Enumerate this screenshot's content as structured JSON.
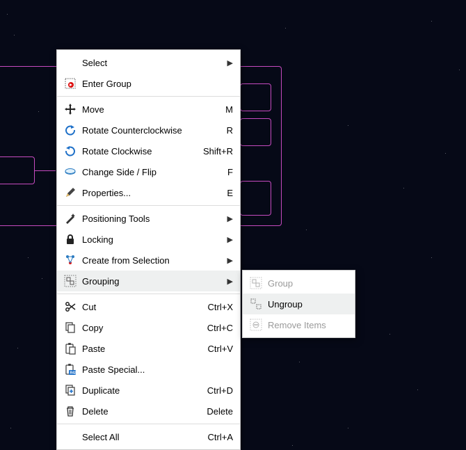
{
  "menu": {
    "select": {
      "label": "Select"
    },
    "enter_group": {
      "label": "Enter Group"
    },
    "move": {
      "label": "Move",
      "key": "M"
    },
    "rot_ccw": {
      "label": "Rotate Counterclockwise",
      "key": "R"
    },
    "rot_cw": {
      "label": "Rotate Clockwise",
      "key": "Shift+R"
    },
    "flip": {
      "label": "Change Side / Flip",
      "key": "F"
    },
    "props": {
      "label": "Properties...",
      "key": "E"
    },
    "pos_tools": {
      "label": "Positioning Tools"
    },
    "locking": {
      "label": "Locking"
    },
    "create_sel": {
      "label": "Create from Selection"
    },
    "grouping": {
      "label": "Grouping"
    },
    "cut": {
      "label": "Cut",
      "key": "Ctrl+X"
    },
    "copy": {
      "label": "Copy",
      "key": "Ctrl+C"
    },
    "paste": {
      "label": "Paste",
      "key": "Ctrl+V"
    },
    "paste_special": {
      "label": "Paste Special..."
    },
    "duplicate": {
      "label": "Duplicate",
      "key": "Ctrl+D"
    },
    "delete": {
      "label": "Delete",
      "key": "Delete"
    },
    "select_all": {
      "label": "Select All",
      "key": "Ctrl+A"
    }
  },
  "submenu": {
    "group": {
      "label": "Group"
    },
    "ungroup": {
      "label": "Ungroup"
    },
    "remove": {
      "label": "Remove Items"
    }
  }
}
